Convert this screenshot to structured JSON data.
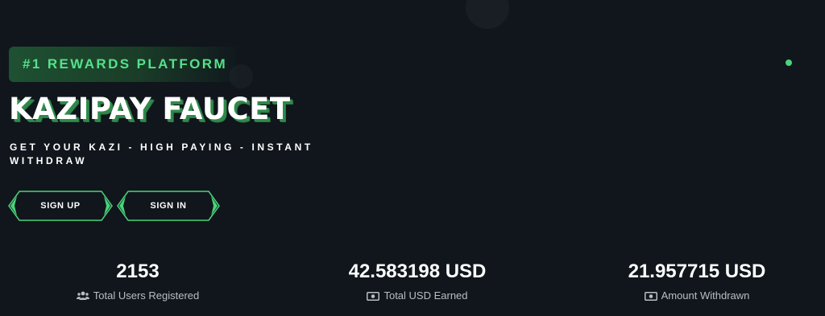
{
  "badge": {
    "text": "#1 REWARDS PLATFORM"
  },
  "hero": {
    "title": "KAZIPAY FAUCET",
    "subtitle": "GET YOUR KAZI - HIGH PAYING - INSTANT WITHDRAW"
  },
  "buttons": {
    "signup": "SIGN UP",
    "signin": "SIGN IN"
  },
  "stats": [
    {
      "value": "2153",
      "label": "Total Users Registered",
      "icon": "users-icon"
    },
    {
      "value": "42.583198 USD",
      "label": "Total USD Earned",
      "icon": "money-icon"
    },
    {
      "value": "21.957715 USD",
      "label": "Amount Withdrawn",
      "icon": "money-icon"
    }
  ],
  "colors": {
    "background": "#10161c",
    "accent": "#4bd37a",
    "badge_bg": "#1e5132",
    "text": "#ffffff",
    "muted": "#b9bec3"
  }
}
